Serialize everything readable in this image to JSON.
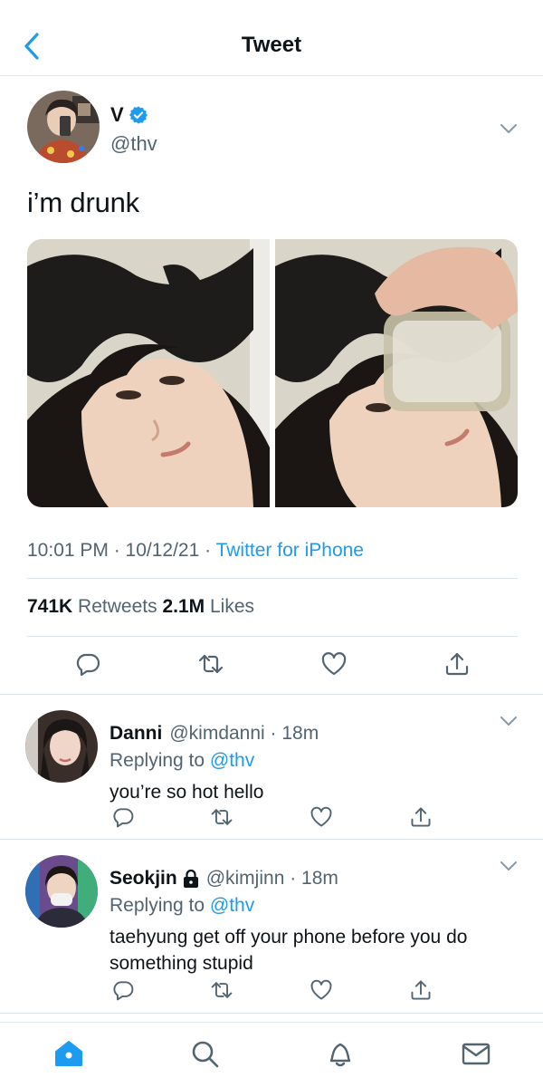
{
  "header": {
    "title": "Tweet"
  },
  "tweet": {
    "name": "V",
    "handle": "@thv",
    "text": "i’m drunk",
    "time": "10:01 PM · 10/12/21 · ",
    "source": "Twitter for iPhone",
    "retweets_count": "741K",
    "retweets_label": "Retweets",
    "likes_count": "2.1M",
    "likes_label": "Likes"
  },
  "replies": [
    {
      "name": "Danni",
      "handle": "@kimdanni · 18m",
      "replying_prefix": "Replying to ",
      "replying_to": "@thv",
      "text": "you’re so hot hello"
    },
    {
      "name": "Seokjin",
      "handle": "@kimjinn · 18m",
      "replying_prefix": "Replying to ",
      "replying_to": "@thv",
      "text": "taehyung get off your phone before you do something stupid"
    }
  ],
  "colors": {
    "accent": "#1d9bf0",
    "secondary_text": "#536471",
    "border": "#e1e8ed"
  },
  "icons": {
    "back": "chevron-left-icon",
    "verified": "verified-badge-icon",
    "reply": "reply-icon",
    "retweet": "retweet-icon",
    "like": "heart-icon",
    "share": "share-icon",
    "home": "home-icon",
    "search": "search-icon",
    "notifications": "bell-icon",
    "messages": "mail-icon",
    "protected": "lock-icon"
  }
}
